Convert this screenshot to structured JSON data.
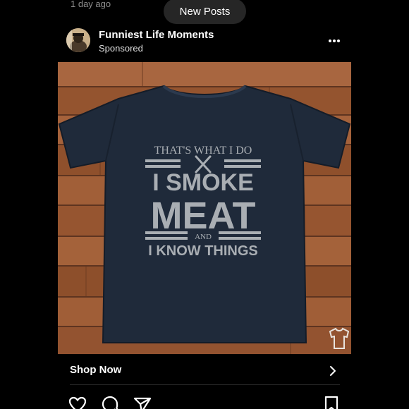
{
  "feed": {
    "previous_post_timestamp": "1 day ago",
    "new_posts_label": "New Posts"
  },
  "post": {
    "account_name": "Funniest Life Moments",
    "sponsored_label": "Sponsored",
    "more_icon": "more-horizontal-icon",
    "image": {
      "shirt_text": {
        "line1": "THAT'S WHAT I DO",
        "line2": "I SMOKE",
        "line3": "MEAT",
        "line4": "AND",
        "line5": "I KNOW THINGS"
      },
      "colors": {
        "wood": "#9a5a36",
        "shirt": "#1f2a3a",
        "print": "#a9aeb3"
      }
    },
    "shop_now_label": "Shop Now",
    "actions": {
      "like_icon": "heart-icon",
      "comment_icon": "comment-icon",
      "share_icon": "paper-plane-icon",
      "save_icon": "bookmark-icon"
    }
  },
  "theme": {
    "background": "#000000",
    "pill_background": "#262626",
    "secondary_text": "#8e8e8e"
  }
}
